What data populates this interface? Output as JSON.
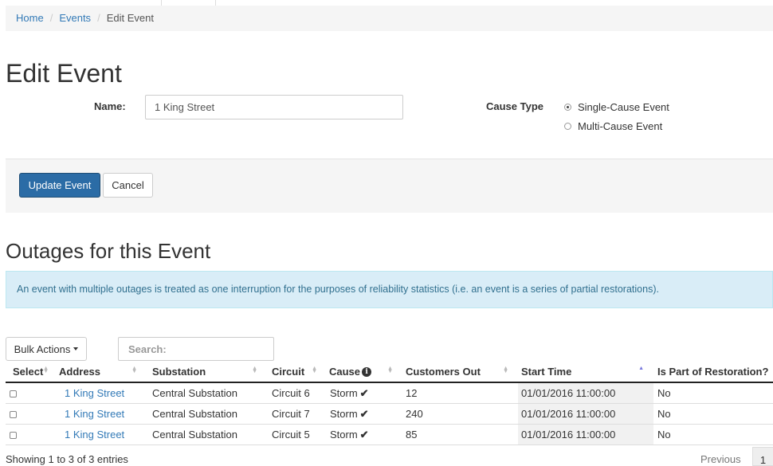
{
  "breadcrumb": {
    "home": "Home",
    "events": "Events",
    "current": "Edit Event"
  },
  "page_title": "Edit Event",
  "form": {
    "name_label": "Name:",
    "name_value": "1 King Street",
    "cause_type_label": "Cause Type",
    "cause_options": [
      {
        "label": "Single-Cause Event",
        "selected": true
      },
      {
        "label": "Multi-Cause Event",
        "selected": false
      }
    ]
  },
  "buttons": {
    "update": "Update Event",
    "cancel": "Cancel"
  },
  "outages": {
    "title": "Outages for this Event",
    "info": "An event with multiple outages is treated as one interruption for the purposes of reliability statistics (i.e. an event is a series of partial restorations).",
    "bulk_actions": "Bulk Actions",
    "search_placeholder": "Search:",
    "columns": [
      "Select",
      "Address",
      "Substation",
      "Circuit",
      "Cause",
      "Customers Out",
      "Start Time",
      "Is Part of Restoration?"
    ],
    "rows": [
      {
        "address": "1 King Street",
        "substation": "Central Substation",
        "circuit": "Circuit 6",
        "cause": "Storm",
        "customers_out": "12",
        "start_time": "01/01/2016 11:00:00",
        "restoration": "No"
      },
      {
        "address": "1 King Street",
        "substation": "Central Substation",
        "circuit": "Circuit 7",
        "cause": "Storm",
        "customers_out": "240",
        "start_time": "01/01/2016 11:00:00",
        "restoration": "No"
      },
      {
        "address": "1 King Street",
        "substation": "Central Substation",
        "circuit": "Circuit 5",
        "cause": "Storm",
        "customers_out": "85",
        "start_time": "01/01/2016 11:00:00",
        "restoration": "No"
      }
    ],
    "entries_info": "Showing 1 to 3 of 3 entries",
    "pagination": {
      "previous": "Previous",
      "current_page": "1"
    }
  },
  "icons": {
    "info": "info-icon",
    "check": "check-icon",
    "caret": "caret-down-icon"
  },
  "colors": {
    "primary": "#2b6ca6",
    "link": "#337ab7",
    "alert_bg": "#d9edf7",
    "alert_text": "#31708f"
  }
}
